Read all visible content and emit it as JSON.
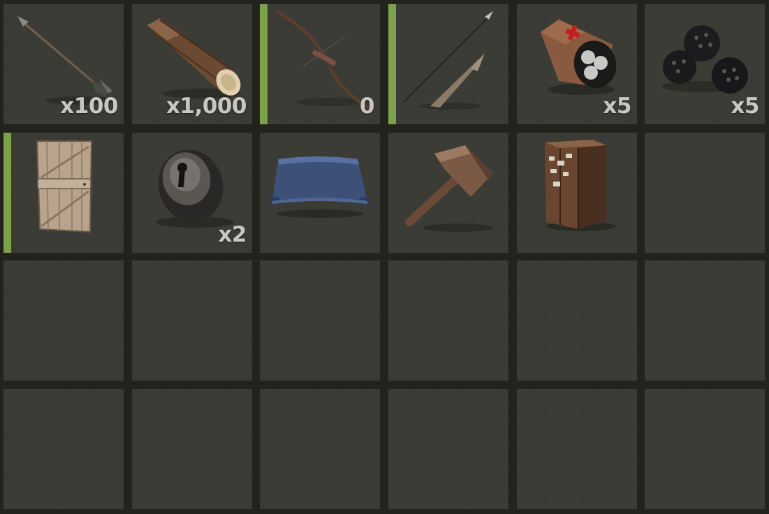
{
  "inventory": {
    "slots": [
      {
        "item": "arrow-icon",
        "quantity": "x100",
        "condition": false
      },
      {
        "item": "wood-log-icon",
        "quantity": "x1,000",
        "condition": false
      },
      {
        "item": "bow-icon",
        "quantity": "0",
        "condition": true
      },
      {
        "item": "spear-icon",
        "quantity": "",
        "condition": true
      },
      {
        "item": "medical-bandage-icon",
        "quantity": "x5",
        "condition": false
      },
      {
        "item": "berries-icon",
        "quantity": "x5",
        "condition": false
      },
      {
        "item": "wooden-door-icon",
        "quantity": "",
        "condition": true
      },
      {
        "item": "key-lock-icon",
        "quantity": "x2",
        "condition": false
      },
      {
        "item": "blueprint-icon",
        "quantity": "",
        "condition": false
      },
      {
        "item": "hammer-icon",
        "quantity": "",
        "condition": false
      },
      {
        "item": "storage-box-icon",
        "quantity": "",
        "condition": false
      },
      {
        "item": "",
        "quantity": "",
        "condition": false
      },
      {
        "item": "",
        "quantity": "",
        "condition": false
      },
      {
        "item": "",
        "quantity": "",
        "condition": false
      },
      {
        "item": "",
        "quantity": "",
        "condition": false
      },
      {
        "item": "",
        "quantity": "",
        "condition": false
      },
      {
        "item": "",
        "quantity": "",
        "condition": false
      },
      {
        "item": "",
        "quantity": "",
        "condition": false
      },
      {
        "item": "",
        "quantity": "",
        "condition": false
      },
      {
        "item": "",
        "quantity": "",
        "condition": false
      },
      {
        "item": "",
        "quantity": "",
        "condition": false
      },
      {
        "item": "",
        "quantity": "",
        "condition": false
      },
      {
        "item": "",
        "quantity": "",
        "condition": false
      },
      {
        "item": "",
        "quantity": "",
        "condition": false
      }
    ]
  },
  "colors": {
    "background": "#23231d",
    "slot": "#3b3b35",
    "condition_bar": "#7da24a",
    "quantity_text": "#c8c8c0"
  }
}
